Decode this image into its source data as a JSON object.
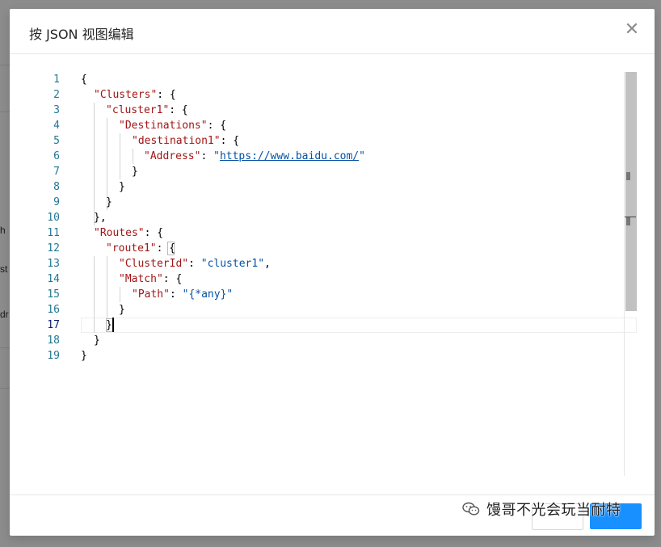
{
  "modal": {
    "title": "按 JSON 视图编辑",
    "close_glyph": "✕"
  },
  "background": {
    "fragments": [
      "h",
      "st",
      "dr"
    ]
  },
  "editor": {
    "line_numbers": [
      "1",
      "2",
      "3",
      "4",
      "5",
      "6",
      "7",
      "8",
      "9",
      "10",
      "11",
      "12",
      "13",
      "14",
      "15",
      "16",
      "17",
      "18",
      "19"
    ],
    "active_line": "17",
    "tokens": {
      "brace_open": "{",
      "brace_close": "}",
      "brace_close_comma": "},",
      "colon_brace": ": {",
      "colon_space": ": ",
      "comma": ",",
      "clusters_key": "\"Clusters\"",
      "cluster1_key": "\"cluster1\"",
      "destinations_key": "\"Destinations\"",
      "destination1_key": "\"destination1\"",
      "address_key": "\"Address\"",
      "address_q": "\"",
      "address_url": "https://www.baidu.com/",
      "routes_key": "\"Routes\"",
      "route1_key": "\"route1\"",
      "clusterid_key": "\"ClusterId\"",
      "clusterid_value": "\"cluster1\"",
      "match_key": "\"Match\"",
      "path_key": "\"Path\"",
      "path_value": "\"{*any}\""
    }
  },
  "footer": {
    "watermark_text": "馒哥不光会玩当耐特"
  },
  "colors": {
    "key": "#a31515",
    "string": "#0451a5",
    "line_number": "#237893",
    "primary_button": "#1890ff"
  }
}
